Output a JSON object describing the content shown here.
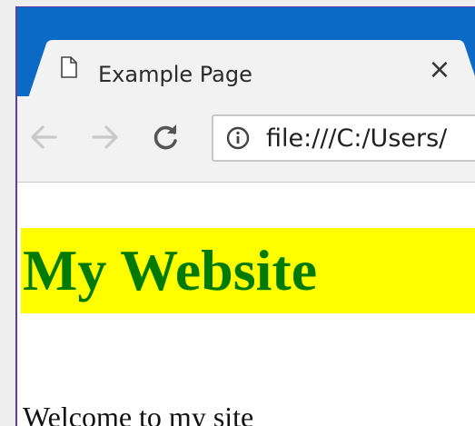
{
  "browser": {
    "tab": {
      "title": "Example Page",
      "close_label": "×"
    },
    "toolbar": {
      "url": "file:///C:/Users/",
      "back_icon": "arrow-left",
      "forward_icon": "arrow-right",
      "reload_icon": "reload",
      "info_icon": "info-circle"
    },
    "colors": {
      "titlebar": "#0a6ac6",
      "toolbar": "#f2f2f2"
    }
  },
  "page": {
    "heading": "My Website",
    "text": "Welcome to my site",
    "colors": {
      "heading_text": "#007a00",
      "heading_background": "#ffff00"
    }
  }
}
